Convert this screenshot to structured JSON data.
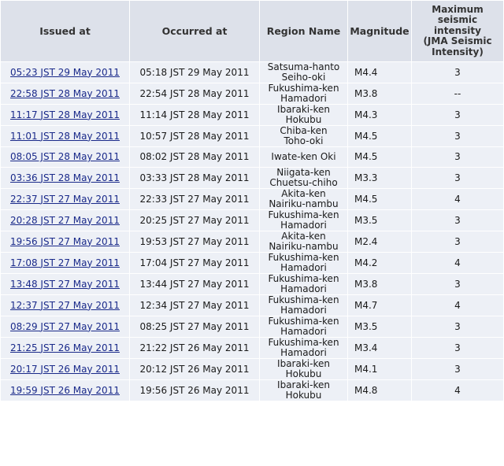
{
  "headers": {
    "issued_at": "Issued at",
    "occurred_at": "Occurred at",
    "region_name": "Region Name",
    "magnitude": "Magnitude",
    "max_intensity": "Maximum\nseismic\nintensity\n(JMA Seismic\nIntensity)"
  },
  "rows": [
    {
      "issued": "05:23 JST 29 May 2011",
      "occurred": "05:18 JST 29 May 2011",
      "region": "Satsuma-hanto\nSeiho-oki",
      "magnitude": "M4.4",
      "intensity": "3"
    },
    {
      "issued": "22:58 JST 28 May 2011",
      "occurred": "22:54 JST 28 May 2011",
      "region": "Fukushima-ken\nHamadori",
      "magnitude": "M3.8",
      "intensity": "--"
    },
    {
      "issued": "11:17 JST 28 May 2011",
      "occurred": "11:14 JST 28 May 2011",
      "region": "Ibaraki-ken\nHokubu",
      "magnitude": "M4.3",
      "intensity": "3"
    },
    {
      "issued": "11:01 JST 28 May 2011",
      "occurred": "10:57 JST 28 May 2011",
      "region": "Chiba-ken\nToho-oki",
      "magnitude": "M4.5",
      "intensity": "3"
    },
    {
      "issued": "08:05 JST 28 May 2011",
      "occurred": "08:02 JST 28 May 2011",
      "region": "Iwate-ken Oki",
      "magnitude": "M4.5",
      "intensity": "3"
    },
    {
      "issued": "03:36 JST 28 May 2011",
      "occurred": "03:33 JST 28 May 2011",
      "region": "Niigata-ken\nChuetsu-chiho",
      "magnitude": "M3.3",
      "intensity": "3"
    },
    {
      "issued": "22:37 JST 27 May 2011",
      "occurred": "22:33 JST 27 May 2011",
      "region": "Akita-ken\nNairiku-nambu",
      "magnitude": "M4.5",
      "intensity": "4"
    },
    {
      "issued": "20:28 JST 27 May 2011",
      "occurred": "20:25 JST 27 May 2011",
      "region": "Fukushima-ken\nHamadori",
      "magnitude": "M3.5",
      "intensity": "3"
    },
    {
      "issued": "19:56 JST 27 May 2011",
      "occurred": "19:53 JST 27 May 2011",
      "region": "Akita-ken\nNairiku-nambu",
      "magnitude": "M2.4",
      "intensity": "3"
    },
    {
      "issued": "17:08 JST 27 May 2011",
      "occurred": "17:04 JST 27 May 2011",
      "region": "Fukushima-ken\nHamadori",
      "magnitude": "M4.2",
      "intensity": "4"
    },
    {
      "issued": "13:48 JST 27 May 2011",
      "occurred": "13:44 JST 27 May 2011",
      "region": "Fukushima-ken\nHamadori",
      "magnitude": "M3.8",
      "intensity": "3"
    },
    {
      "issued": "12:37 JST 27 May 2011",
      "occurred": "12:34 JST 27 May 2011",
      "region": "Fukushima-ken\nHamadori",
      "magnitude": "M4.7",
      "intensity": "4"
    },
    {
      "issued": "08:29 JST 27 May 2011",
      "occurred": "08:25 JST 27 May 2011",
      "region": "Fukushima-ken\nHamadori",
      "magnitude": "M3.5",
      "intensity": "3"
    },
    {
      "issued": "21:25 JST 26 May 2011",
      "occurred": "21:22 JST 26 May 2011",
      "region": "Fukushima-ken\nHamadori",
      "magnitude": "M3.4",
      "intensity": "3"
    },
    {
      "issued": "20:17 JST 26 May 2011",
      "occurred": "20:12 JST 26 May 2011",
      "region": "Ibaraki-ken\nHokubu",
      "magnitude": "M4.1",
      "intensity": "3"
    },
    {
      "issued": "19:59 JST 26 May 2011",
      "occurred": "19:56 JST 26 May 2011",
      "region": "Ibaraki-ken\nHokubu",
      "magnitude": "M4.8",
      "intensity": "4"
    }
  ]
}
